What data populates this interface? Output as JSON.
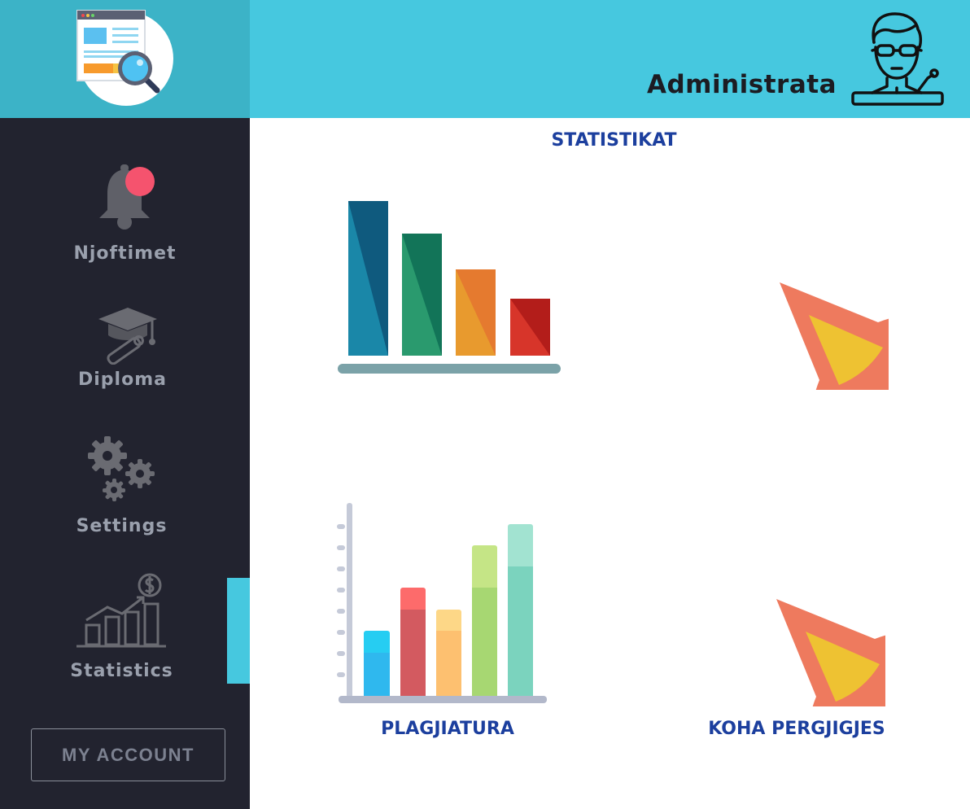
{
  "header": {
    "title": "Administrata"
  },
  "sidebar": {
    "items": [
      {
        "label": "Njoftimet",
        "icon": "bell-icon"
      },
      {
        "label": "Diploma",
        "icon": "graduation-cap-icon"
      },
      {
        "label": "Settings",
        "icon": "gears-icon"
      },
      {
        "label": "Statistics",
        "icon": "statistics-icon"
      }
    ],
    "account_button": "MY ACCOUNT"
  },
  "main": {
    "title": "STATISTIKAT",
    "cards": [
      {
        "label": ""
      },
      {
        "label": ""
      },
      {
        "label": "PLAGJIATURA"
      },
      {
        "label": "KOHA PERGJIGJES"
      }
    ]
  },
  "colors": {
    "header": "#46c8df",
    "sidebar": "#22232f",
    "accent_text": "#1c3f9e",
    "active_marker": "#46c8df"
  }
}
